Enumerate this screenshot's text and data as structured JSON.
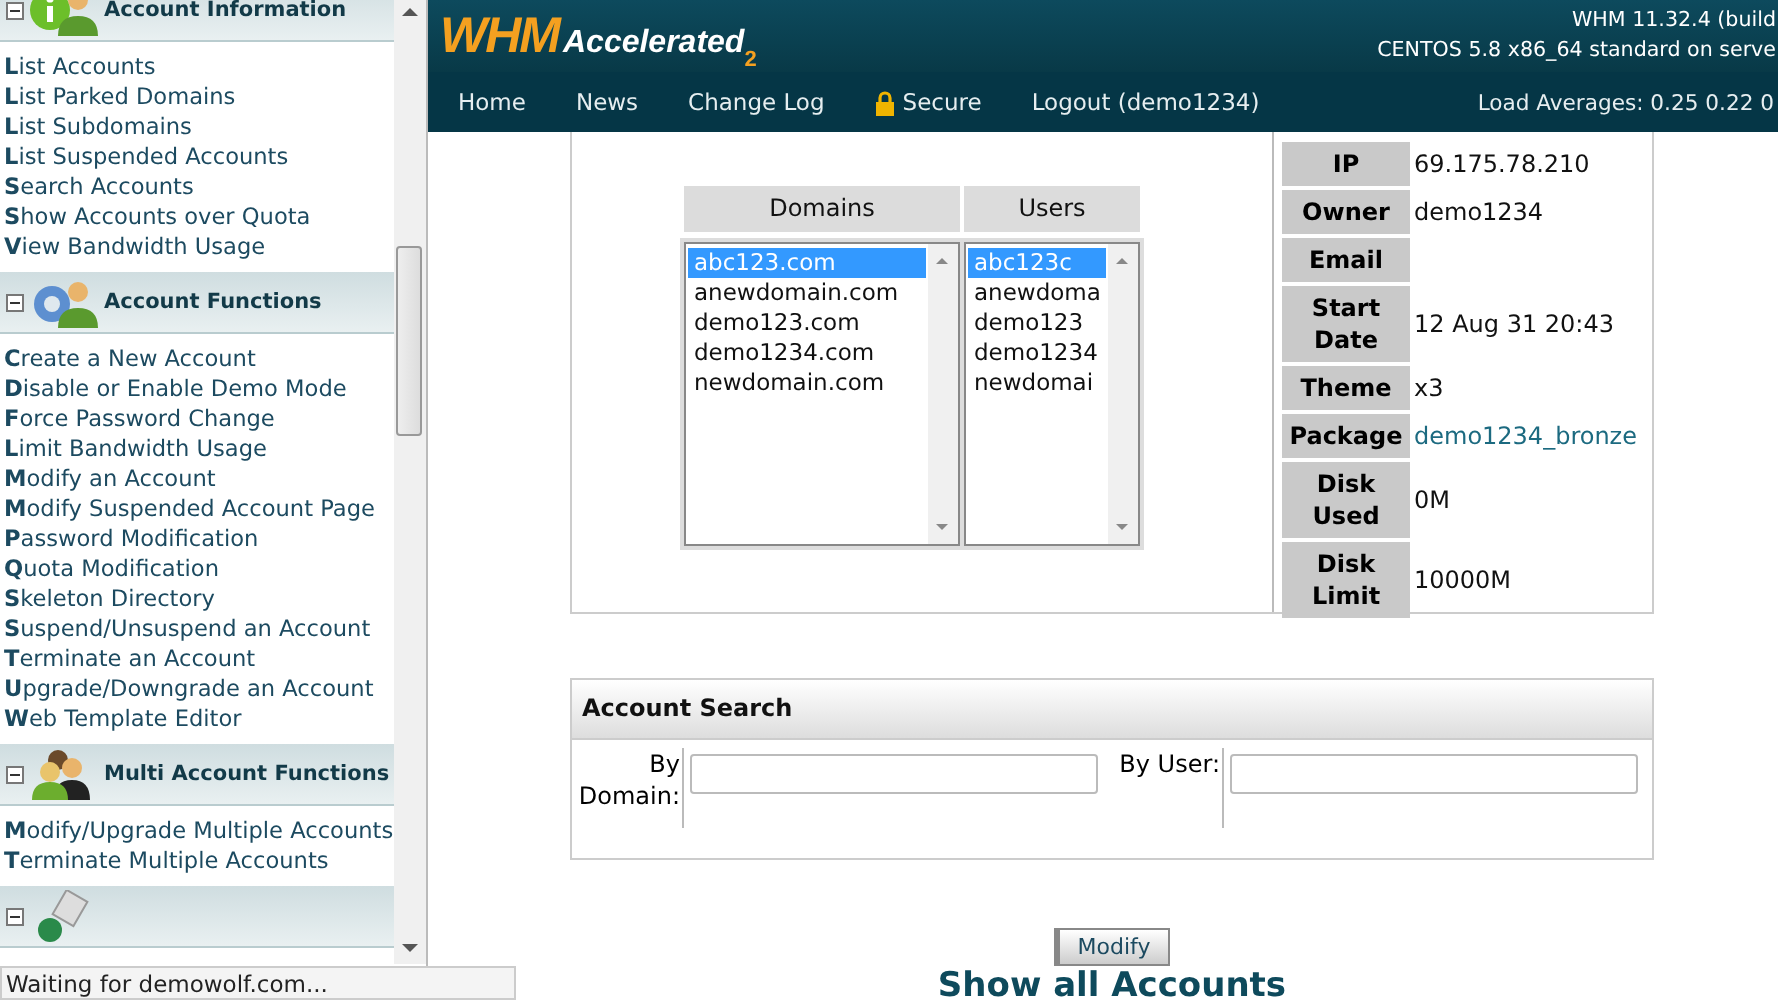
{
  "sidebar": {
    "sections": [
      {
        "kind": "info",
        "title": "Account Information",
        "expanded": true,
        "items": [
          "**L**ist Accounts",
          "**L**ist Parked Domains",
          "**L**ist Subdomains",
          "**L**ist Suspended Accounts",
          "**S**earch Accounts",
          "**S**how Accounts over Quota",
          "**V**iew Bandwidth Usage"
        ]
      },
      {
        "kind": "gear",
        "title": "Account Functions",
        "expanded": true,
        "items": [
          "**C**reate a New Account",
          "**D**isable or Enable Demo Mode",
          "**F**orce Password Change",
          "**L**imit Bandwidth Usage",
          "**M**odify an Account",
          "**M**odify Suspended Account Page",
          "**P**assword Modification",
          "**Q**uota Modification",
          "**S**keleton Directory",
          "**S**uspend/Unsuspend an Account",
          "**T**erminate an Account",
          "**U**pgrade/Downgrade an Account",
          "**W**eb Template Editor"
        ]
      },
      {
        "kind": "users",
        "title": "Multi Account Functions",
        "expanded": true,
        "items": [
          "**M**odify/Upgrade Multiple Accounts",
          "**T**erminate Multiple Accounts"
        ]
      },
      {
        "kind": "frontpage",
        "expanded": true
      }
    ]
  },
  "header": {
    "logo": {
      "main": "WHM",
      "sub": "Accelerated",
      "badge": "2"
    },
    "version": "WHM 11.32.4 (build",
    "system": "CENTOS 5.8 x86_64 standard on serve"
  },
  "nav": {
    "items": [
      {
        "label": "Home"
      },
      {
        "label": "News"
      },
      {
        "label": "Change Log"
      },
      {
        "label": "Secure",
        "kind": "lock"
      },
      {
        "label": "Logout (demo1234)"
      }
    ],
    "load": "Load Averages: 0.25 0.22 0"
  },
  "lists": [
    {
      "heading": "Domains",
      "items": [
        {
          "text": "abc123.com",
          "selected": true
        },
        {
          "text": "anewdomain.com",
          "selected": false
        },
        {
          "text": "demo123.com",
          "selected": false
        },
        {
          "text": "demo1234.com",
          "selected": false
        },
        {
          "text": "newdomain.com",
          "selected": false
        }
      ]
    },
    {
      "heading": "Users",
      "items": [
        {
          "text": "abc123c",
          "selected": true
        },
        {
          "text": "anewdoma",
          "selected": false
        },
        {
          "text": "demo123",
          "selected": false
        },
        {
          "text": "demo1234",
          "selected": false
        },
        {
          "text": "newdomai",
          "selected": false
        }
      ]
    }
  ],
  "details": [
    {
      "label": "IP",
      "value": "69.175.78.210",
      "link": false
    },
    {
      "label": "Owner",
      "value": "demo1234",
      "link": false
    },
    {
      "label": "Email"
    },
    {
      "label": "Start Date",
      "value": "12 Aug 31 20:43",
      "link": false
    },
    {
      "label": "Theme",
      "value": "x3",
      "link": false
    },
    {
      "label": "Package",
      "value": "demo1234_bronze",
      "link": true
    },
    {
      "label": "Disk Used",
      "value": "0M",
      "link": false
    },
    {
      "label": "Disk Limit",
      "value": "10000M",
      "link": false
    }
  ],
  "search": {
    "title": "Account Search",
    "fields": [
      {
        "label": "By Domain:"
      },
      {
        "label": "By User:"
      }
    ]
  },
  "modify_button": "Modify",
  "show_all_heading": "Show all Accounts",
  "status_bar": "Waiting for demowolf.com..."
}
